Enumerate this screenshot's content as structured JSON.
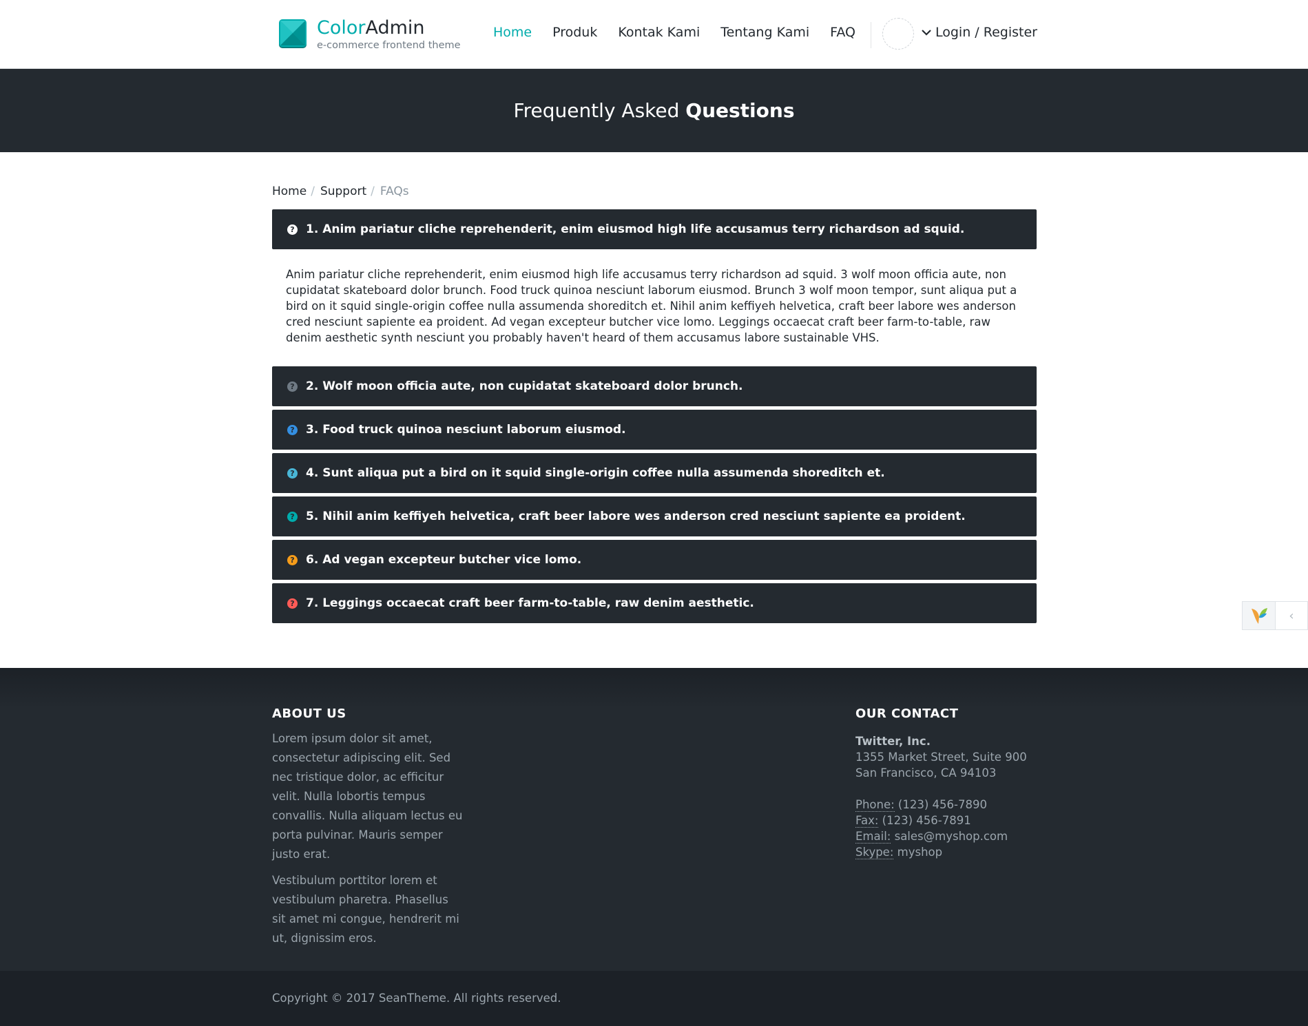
{
  "brand": {
    "name_accent": "Color",
    "name_rest": "Admin",
    "tagline": "e-commerce frontend theme",
    "logo_color": "#00acac"
  },
  "nav": {
    "items": [
      {
        "label": "Home",
        "active": true
      },
      {
        "label": "Produk",
        "active": false
      },
      {
        "label": "Kontak Kami",
        "active": false
      },
      {
        "label": "Tentang Kami",
        "active": false
      },
      {
        "label": "FAQ",
        "active": false
      }
    ],
    "login_label": "Login / Register"
  },
  "title": {
    "light": "Frequently Asked",
    "bold": "Questions"
  },
  "breadcrumb": {
    "items": [
      "Home",
      "Support"
    ],
    "current": "FAQs"
  },
  "faq": {
    "items": [
      {
        "question": "1. Anim pariatur cliche reprehenderit, enim eiusmod high life accusamus terry richardson ad squid.",
        "icon_color": "#ffffff"
      },
      {
        "question": "2. Wolf moon officia aute, non cupidatat skateboard dolor brunch.",
        "icon_color": "#6f7a84"
      },
      {
        "question": "3. Food truck quinoa nesciunt laborum eiusmod.",
        "icon_color": "#348fe2"
      },
      {
        "question": "4. Sunt aliqua put a bird on it squid single-origin coffee nulla assumenda shoreditch et.",
        "icon_color": "#49b6d6"
      },
      {
        "question": "5. Nihil anim keffiyeh helvetica, craft beer labore wes anderson cred nesciunt sapiente ea proident.",
        "icon_color": "#00acac"
      },
      {
        "question": "6. Ad vegan excepteur butcher vice lomo.",
        "icon_color": "#f59c1a"
      },
      {
        "question": "7. Leggings occaecat craft beer farm-to-table, raw denim aesthetic.",
        "icon_color": "#ff5b57"
      }
    ],
    "open_answer": "Anim pariatur cliche reprehenderit, enim eiusmod high life accusamus terry richardson ad squid. 3 wolf moon officia aute, non cupidatat skateboard dolor brunch. Food truck quinoa nesciunt laborum eiusmod. Brunch 3 wolf moon tempor, sunt aliqua put a bird on it squid single-origin coffee nulla assumenda shoreditch et. Nihil anim keffiyeh helvetica, craft beer labore wes anderson cred nesciunt sapiente ea proident. Ad vegan excepteur butcher vice lomo. Leggings occaecat craft beer farm-to-table, raw denim aesthetic synth nesciunt you probably haven't heard of them accusamus labore sustainable VHS."
  },
  "side_widget": {
    "toggle_glyph": "‹"
  },
  "footer": {
    "about": {
      "heading": "ABOUT US",
      "p1": "Lorem ipsum dolor sit amet, consectetur adipiscing elit. Sed nec tristique dolor, ac efficitur velit. Nulla lobortis tempus convallis. Nulla aliquam lectus eu porta pulvinar. Mauris semper justo erat.",
      "p2": "Vestibulum porttitor lorem et vestibulum pharetra. Phasellus sit amet mi congue, hendrerit mi ut, dignissim eros."
    },
    "contact": {
      "heading": "OUR CONTACT",
      "company": "Twitter, Inc.",
      "address1": "1355 Market Street, Suite 900",
      "address2": "San Francisco, CA 94103",
      "phone_label": "Phone:",
      "phone": "(123) 456-7890",
      "fax_label": "Fax:",
      "fax": "(123) 456-7891",
      "email_label": "Email:",
      "email": "sales@myshop.com",
      "skype_label": "Skype:",
      "skype": "myshop"
    },
    "copyright": "Copyright © 2017 SeanTheme. All rights reserved."
  }
}
